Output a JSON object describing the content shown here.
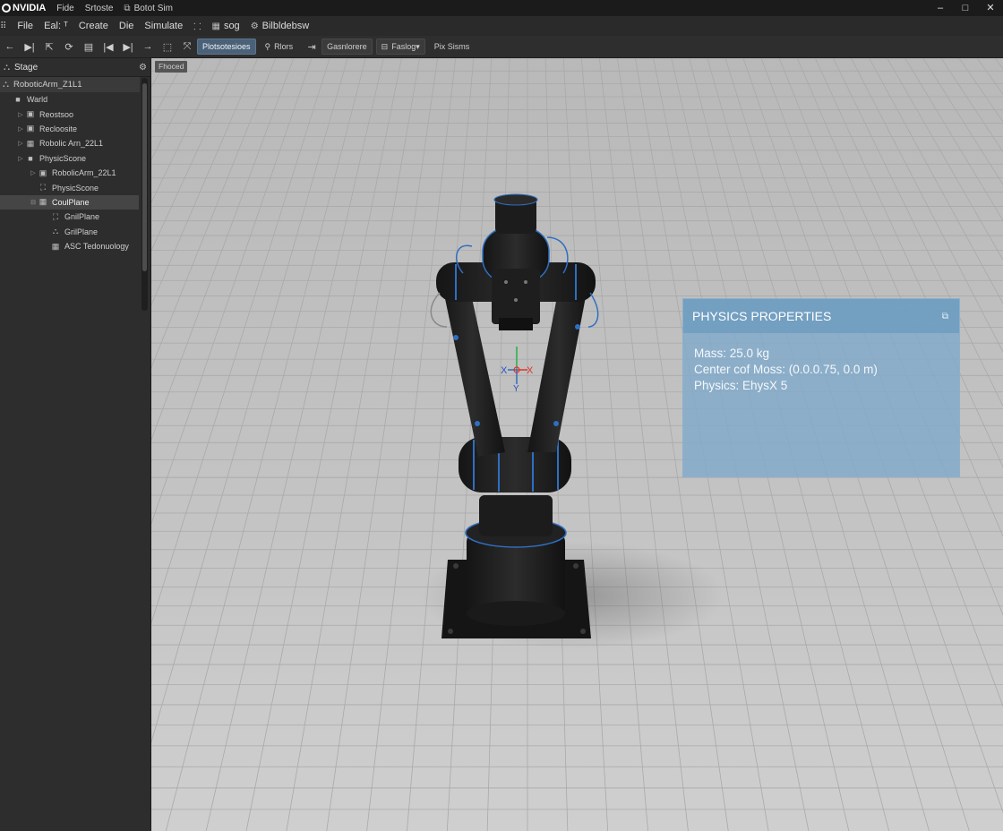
{
  "titlebar": {
    "brand": "NVIDIA",
    "menu": [
      "Fide",
      "Srtoste"
    ],
    "app_title": "Botot Sim",
    "buttons": {
      "minimize": "–",
      "maximize": "□",
      "close": "✕"
    }
  },
  "menubar": {
    "items": [
      "File",
      "Eal: ᵀ",
      "Create",
      "Die",
      "Simulate",
      "sog",
      "Bilbldebsw"
    ]
  },
  "toolbar": {
    "buttons": [
      "Plotsotesioes",
      "Rlors",
      "Gasnlorere",
      "Faslog▾",
      "Pix Sisms"
    ]
  },
  "stage": {
    "title": "Stage",
    "selected_prim": "RoboticArm_Z1L1",
    "tree": [
      {
        "label": "Warld",
        "indent": 0,
        "expander": "",
        "icon": "■"
      },
      {
        "label": "Reostsoo",
        "indent": 1,
        "expander": "▷",
        "icon": "▣"
      },
      {
        "label": "Recloosite",
        "indent": 1,
        "expander": "▷",
        "icon": "▣"
      },
      {
        "label": "Robolic Arn_22L1",
        "indent": 1,
        "expander": "▷",
        "icon": "▦"
      },
      {
        "label": "PhysicScone",
        "indent": 1,
        "expander": "▷",
        "icon": "■"
      },
      {
        "label": "RobolicArm_22L1",
        "indent": 2,
        "expander": "▷",
        "icon": "▣"
      },
      {
        "label": "PhysicScone",
        "indent": 2,
        "expander": "",
        "icon": "⛶"
      },
      {
        "label": "CoulPlane",
        "indent": 2,
        "expander": "⊟",
        "icon": "▦",
        "selected": true
      },
      {
        "label": "GnilPlane",
        "indent": 3,
        "expander": "",
        "icon": "⛶"
      },
      {
        "label": "GrilPlane",
        "indent": 3,
        "expander": "",
        "icon": "⛬"
      },
      {
        "label": "ASC Tedonuology",
        "indent": 3,
        "expander": "",
        "icon": "▦"
      }
    ]
  },
  "viewport": {
    "camera_label": "Fhoced",
    "gizmo": {
      "x": "X",
      "y": "Y"
    }
  },
  "physics_panel": {
    "title": "PHYSICS PROPERTIES",
    "mass": "Mass: 25.0 kg",
    "center_of_mass": "Center cof Moss: (0.0.0.75, 0.0 m)",
    "physics_engine": "Physics: EhysX 5"
  },
  "colors": {
    "accent_blue": "#2f6fc2",
    "panel_bg": "#80aaca",
    "selected_tool": "#4a6178"
  }
}
